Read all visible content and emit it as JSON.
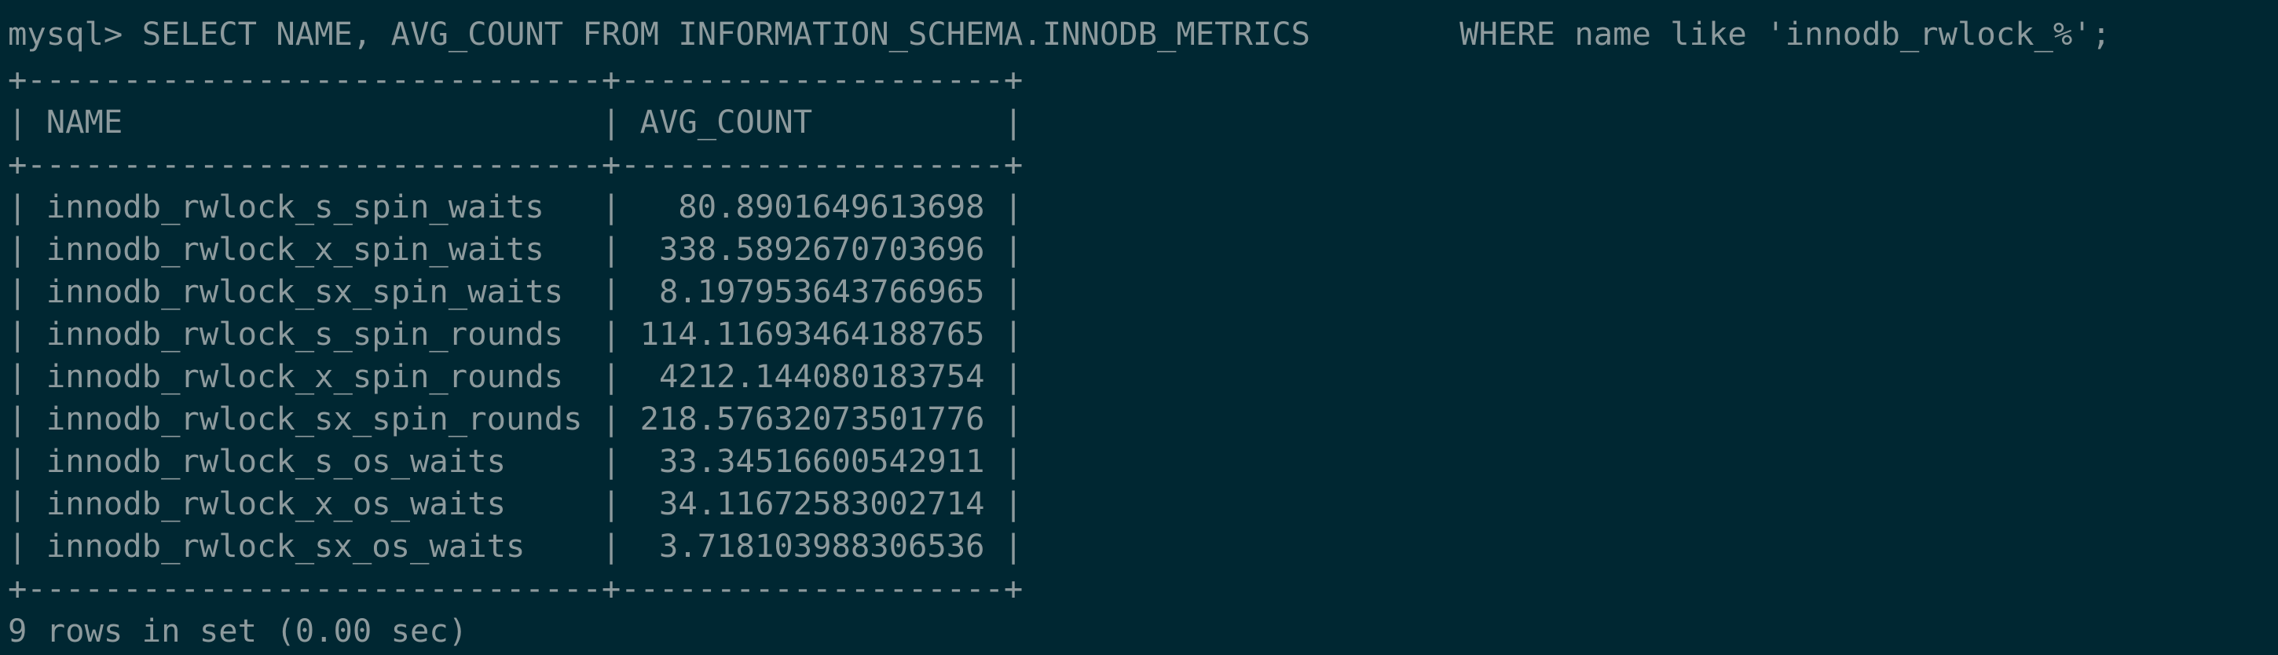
{
  "terminal": {
    "prompt": "mysql> ",
    "query_part1": "SELECT NAME, AVG_COUNT FROM INFORMATION_SCHEMA.INNODB_METRICS",
    "query_part2": "WHERE name like 'innodb_rwlock_%';",
    "border": "+------------------------------+--------------------+",
    "header": "| NAME                         | AVG_COUNT          |",
    "rows": [
      "| innodb_rwlock_s_spin_waits   |   80.8901649613698 |",
      "| innodb_rwlock_x_spin_waits   |  338.5892670703696 |",
      "| innodb_rwlock_sx_spin_waits  |  8.197953643766965 |",
      "| innodb_rwlock_s_spin_rounds  | 114.11693464188765 |",
      "| innodb_rwlock_x_spin_rounds  |  4212.144080183754 |",
      "| innodb_rwlock_sx_spin_rounds | 218.57632073501776 |",
      "| innodb_rwlock_s_os_waits     |  33.34516600542911 |",
      "| innodb_rwlock_x_os_waits     |  34.11672583002714 |",
      "| innodb_rwlock_sx_os_waits    |  3.718103988306536 |"
    ],
    "footer": "9 rows in set (0.00 sec)"
  }
}
